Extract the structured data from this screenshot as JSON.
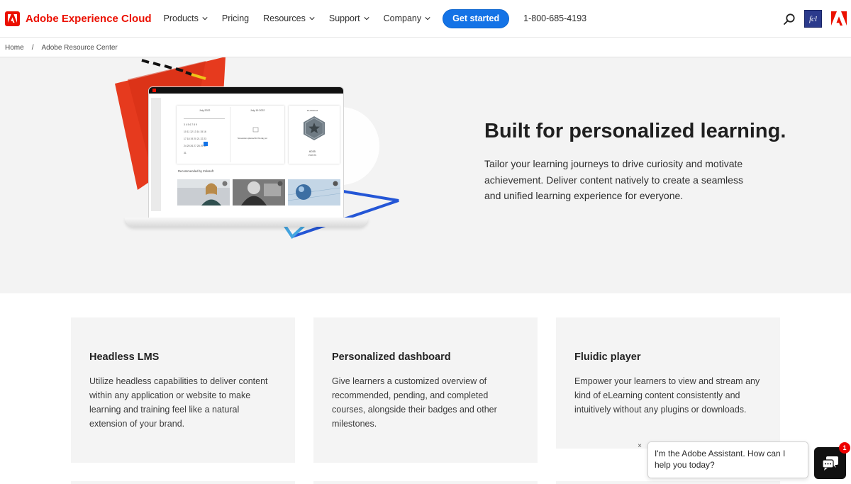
{
  "header": {
    "brand_name": "Adobe Experience Cloud",
    "nav": [
      {
        "label": "Products"
      },
      {
        "label": "Pricing"
      },
      {
        "label": "Resources"
      },
      {
        "label": "Support"
      },
      {
        "label": "Company"
      }
    ],
    "cta_label": "Get started",
    "phone": "1-800-685-4193",
    "avatar_initials": "fcl",
    "search_icon": "search-icon",
    "brand_color": "#eb1000",
    "accent_color": "#1473e6"
  },
  "breadcrumb": {
    "home": "Home",
    "separator": "/",
    "current": "Adobe Resource Center"
  },
  "hero": {
    "title": "Built for personalized learning.",
    "body": "Tailor your learning journeys to drive curiosity and motivate achievement. Deliver content natively to create a seamless and unified learning experience for everyone.",
    "screen": {
      "calendar_month": "July 2022",
      "day_title": "July 19 2022",
      "day_empty": "No sessions planned for this day yet",
      "badge_level": "PLATINUM",
      "points_value": "6035",
      "points_label": "POINTS",
      "recommended_heading": "Recommended by Zolosoft"
    }
  },
  "cards": [
    {
      "title": "Headless LMS",
      "body": "Utilize headless capabilities to deliver content within any application or website to make learning and training feel like a natural extension of your brand."
    },
    {
      "title": "Personalized dashboard",
      "body": "Give learners a customized overview of recommended, pending, and completed courses, alongside their badges and other milestones."
    },
    {
      "title": "Fluidic player",
      "body": "Empower your learners to view and stream any kind of eLearning content consistently and intuitively without any plugins or downloads."
    }
  ],
  "chat": {
    "message": "I'm the Adobe Assistant. How can I help you today?",
    "close": "×",
    "badge_count": "1"
  }
}
